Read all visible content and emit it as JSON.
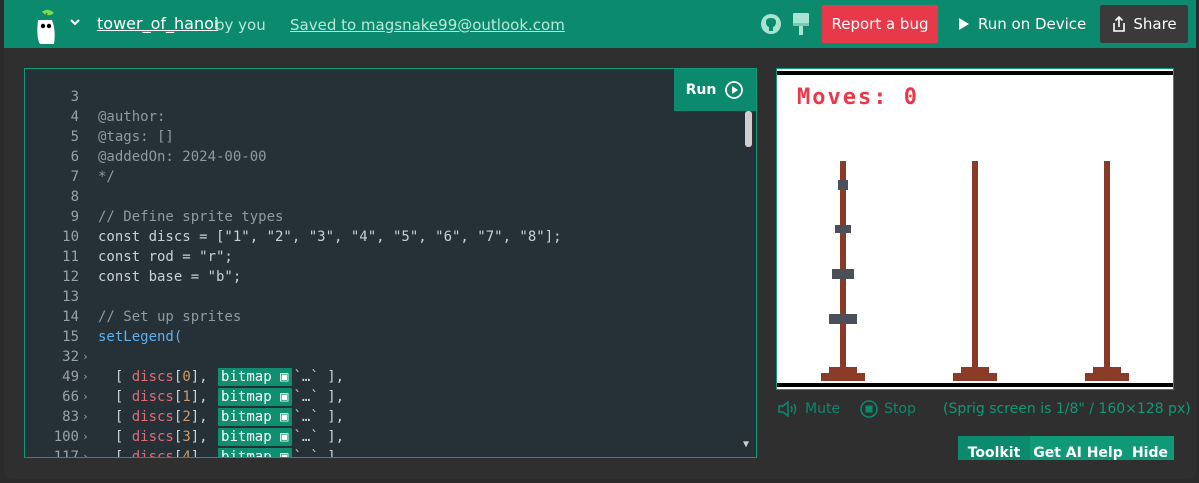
{
  "header": {
    "project_name": "tower_of_hanoi",
    "owner": "by you",
    "saved": "Saved to magsnake99@outlook.com",
    "report_bug": "Report a bug",
    "run_on_device": "Run on Device",
    "share": "Share"
  },
  "editor": {
    "run_label": "Run",
    "lines": [
      {
        "n": "3",
        "t": "@author:"
      },
      {
        "n": "4",
        "t": "@tags: []"
      },
      {
        "n": "5",
        "t": "@addedOn: 2024-00-00"
      },
      {
        "n": "6",
        "t": "*/"
      },
      {
        "n": "7",
        "t": ""
      },
      {
        "n": "8",
        "t": "// Define sprite types"
      },
      {
        "n": "9",
        "t": "const discs = [\"1\", \"2\", \"3\", \"4\", \"5\", \"6\", \"7\", \"8\"];"
      },
      {
        "n": "10",
        "t": "const rod = \"r\";"
      },
      {
        "n": "11",
        "t": "const base = \"b\";"
      },
      {
        "n": "12",
        "t": ""
      },
      {
        "n": "13",
        "t": "// Set up sprites"
      },
      {
        "n": "14",
        "t": "setLegend("
      }
    ],
    "legend_rows": [
      {
        "n": "15",
        "i": "0"
      },
      {
        "n": "32",
        "i": "1"
      },
      {
        "n": "49",
        "i": "2"
      },
      {
        "n": "66",
        "i": "3"
      },
      {
        "n": "83",
        "i": "4"
      },
      {
        "n": "100",
        "i": "5"
      },
      {
        "n": "117",
        "i": "6"
      }
    ],
    "bitmap_label": "bitmap"
  },
  "game": {
    "moves_label": "Moves: 0"
  },
  "controls": {
    "mute": "Mute",
    "stop": "Stop",
    "screen_info": "(Sprig screen is 1/8\" / 160×128 px)"
  },
  "bottom_tabs": {
    "toolkit": "Toolkit",
    "ai_help": "Get AI Help",
    "hide": "Hide"
  },
  "colors": {
    "accent": "#0b8a6d",
    "bug": "#e8394a",
    "editor_bg": "#253037",
    "rod": "#8a3b28",
    "disc": "#4a4f58"
  }
}
